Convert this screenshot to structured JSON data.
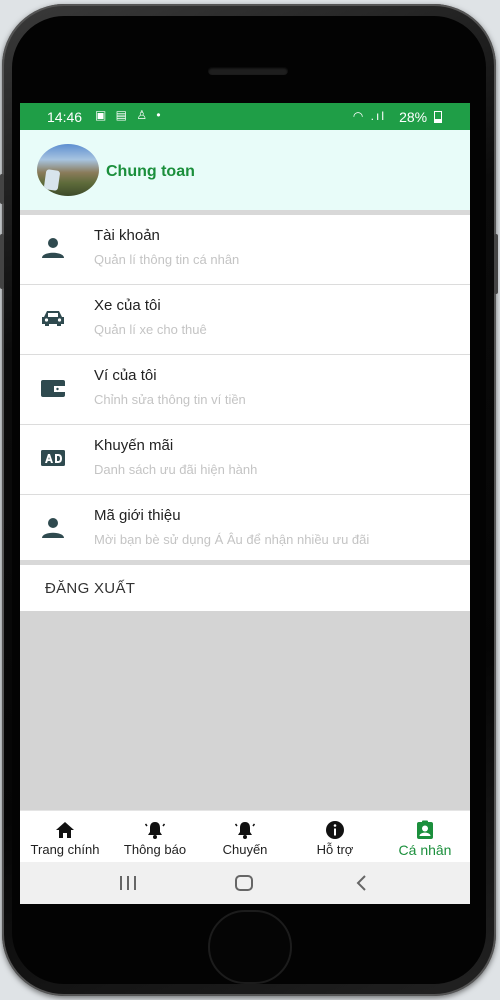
{
  "status_bar": {
    "time": "14:46",
    "notification_icons": "▣ ▤ ♙ •",
    "signal": "◠ .ıl",
    "battery": "28%"
  },
  "profile": {
    "name": "Chung toan"
  },
  "menu": {
    "items": [
      {
        "icon": "person-icon",
        "title": "Tài khoản",
        "subtitle": "Quản lí thông tin cá nhân"
      },
      {
        "icon": "car-icon",
        "title": "Xe của tôi",
        "subtitle": "Quản lí xe cho thuê"
      },
      {
        "icon": "wallet-icon",
        "title": "Ví của tôi",
        "subtitle": "Chỉnh sửa thông tin ví tiền"
      },
      {
        "icon": "ad-icon",
        "title": "Khuyến mãi",
        "subtitle": "Danh sách ưu đãi hiện hành"
      },
      {
        "icon": "person-icon",
        "title": "Mã giới thiệu",
        "subtitle": "Mời bạn bè sử dụng Á Âu để nhận nhiều ưu đãi"
      }
    ],
    "logout_label": "ĐĂNG XUẤT"
  },
  "tabs": [
    {
      "icon": "home-icon",
      "label": "Trang chính",
      "active": false
    },
    {
      "icon": "bell-icon",
      "label": "Thông báo",
      "active": false
    },
    {
      "icon": "bell-icon",
      "label": "Chuyến",
      "active": false
    },
    {
      "icon": "info-icon",
      "label": "Hỗ trợ",
      "active": false
    },
    {
      "icon": "profile-card-icon",
      "label": "Cá nhân",
      "active": true
    }
  ],
  "colors": {
    "brand_green": "#1f9e47",
    "active_tab": "#1b8f3c",
    "icon_dark": "#2f4a4f",
    "header_bg": "#e8fcf9"
  }
}
